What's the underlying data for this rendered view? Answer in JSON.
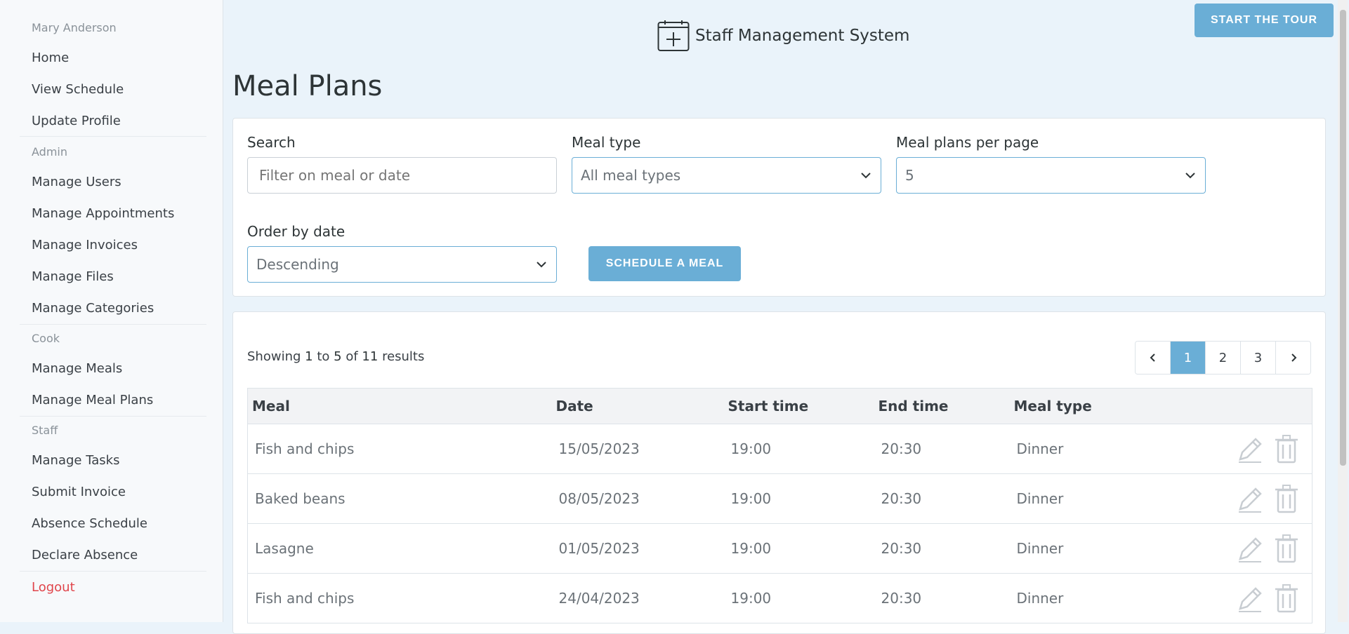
{
  "sidebar": {
    "user_name": "Mary Anderson",
    "items_top": [
      "Home",
      "View Schedule",
      "Update Profile"
    ],
    "section_admin": "Admin",
    "items_admin": [
      "Manage Users",
      "Manage Appointments",
      "Manage Invoices",
      "Manage Files",
      "Manage Categories"
    ],
    "section_cook": "Cook",
    "items_cook": [
      "Manage Meals",
      "Manage Meal Plans"
    ],
    "section_staff": "Staff",
    "items_staff": [
      "Manage Tasks",
      "Submit Invoice",
      "Absence Schedule",
      "Declare Absence"
    ],
    "logout": "Logout"
  },
  "header": {
    "brand": "Staff Management System",
    "tour_button": "START THE TOUR",
    "page_title": "Meal Plans"
  },
  "filters": {
    "search_label": "Search",
    "search_placeholder": "Filter on meal or date",
    "meal_type_label": "Meal type",
    "meal_type_value": "All meal types",
    "per_page_label": "Meal plans per page",
    "per_page_value": "5",
    "order_label": "Order by date",
    "order_value": "Descending",
    "schedule_button": "SCHEDULE A MEAL"
  },
  "results": {
    "showing_prefix": "Showing",
    "from": "1",
    "to_word": "to",
    "to": "5",
    "of_word": "of",
    "total": "11",
    "suffix": "results",
    "pages": [
      "1",
      "2",
      "3"
    ],
    "current_page": "1"
  },
  "table": {
    "headers": [
      "Meal",
      "Date",
      "Start time",
      "End time",
      "Meal type"
    ],
    "rows": [
      {
        "meal": "Fish and chips",
        "date": "15/05/2023",
        "start": "19:00",
        "end": "20:30",
        "type": "Dinner"
      },
      {
        "meal": "Baked beans",
        "date": "08/05/2023",
        "start": "19:00",
        "end": "20:30",
        "type": "Dinner"
      },
      {
        "meal": "Lasagne",
        "date": "01/05/2023",
        "start": "19:00",
        "end": "20:30",
        "type": "Dinner"
      },
      {
        "meal": "Fish and chips",
        "date": "24/04/2023",
        "start": "19:00",
        "end": "20:30",
        "type": "Dinner"
      }
    ]
  },
  "colors": {
    "accent": "#6aaed6",
    "logout": "#e0454b"
  },
  "icons": {
    "brand": "calendar-plus-icon",
    "edit": "pencil-icon",
    "delete": "trash-icon",
    "dropdown": "chevron-down-icon"
  }
}
